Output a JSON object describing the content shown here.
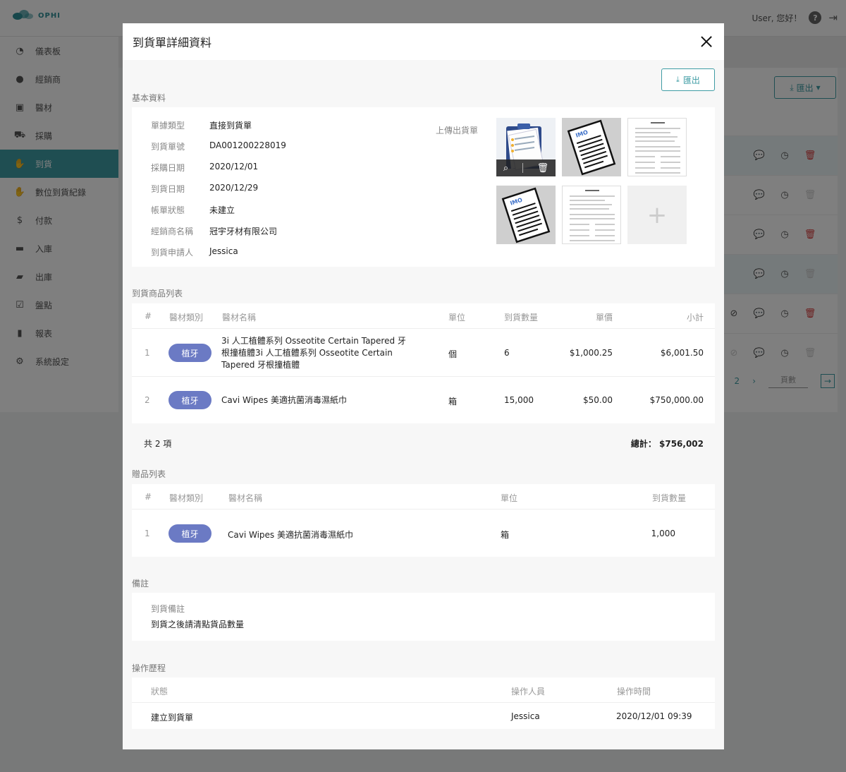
{
  "app": {
    "logo_text": "OPHI",
    "greeting": "User, 您好！",
    "help_glyph": "?",
    "logout_glyph": "⇥",
    "sidebar": [
      {
        "label": "儀表板",
        "icon": "dashboard-icon",
        "glyph": "◔",
        "active": false
      },
      {
        "label": "經銷商",
        "icon": "user-icon",
        "glyph": "●",
        "active": false
      },
      {
        "label": "醫材",
        "icon": "box-icon",
        "glyph": "▣",
        "active": false
      },
      {
        "label": "採購",
        "icon": "cart-icon",
        "glyph": "⛟",
        "active": false
      },
      {
        "label": "到貨",
        "icon": "handshake-icon",
        "glyph": "✋",
        "active": true
      },
      {
        "label": "數位到貨紀錄",
        "icon": "handshake-icon",
        "glyph": "✋",
        "active": false
      },
      {
        "label": "付款",
        "icon": "dollar-icon",
        "glyph": "$",
        "active": false
      },
      {
        "label": "入庫",
        "icon": "inbox-icon",
        "glyph": "▬",
        "active": false
      },
      {
        "label": "出庫",
        "icon": "outbox-icon",
        "glyph": "▰",
        "active": false
      },
      {
        "label": "盤點",
        "icon": "checklist-icon",
        "glyph": "☑",
        "active": false
      },
      {
        "label": "報表",
        "icon": "bar-chart-icon",
        "glyph": "▮",
        "active": false
      },
      {
        "label": "系統設定",
        "icon": "gear-icon",
        "glyph": "⚙",
        "active": false
      }
    ],
    "export_label": "匯出",
    "pager": {
      "page": "2",
      "next": "›",
      "input_placeholder": "頁數",
      "go": "→"
    }
  },
  "modal": {
    "title": "到貨單詳細資料",
    "export_label": "匯出",
    "basic": {
      "section_title": "基本資料",
      "fields": [
        {
          "label": "單據類型",
          "value": "直接到貨單"
        },
        {
          "label": "到貨單號",
          "value": "DA001200228019"
        },
        {
          "label": "採購日期",
          "value": "2020/12/01"
        },
        {
          "label": "到貨日期",
          "value": "2020/12/29"
        },
        {
          "label": "帳單狀態",
          "value": "未建立"
        },
        {
          "label": "經銷商名稱",
          "value": "冠宇牙材有限公司"
        },
        {
          "label": "到貨申請人",
          "value": "Jessica"
        }
      ],
      "upload_label": "上傳出貨單",
      "add_glyph": "+",
      "zoom_glyph": "⌕",
      "trash_glyph": "🗑"
    },
    "products": {
      "section_title": "到貨商品列表",
      "headers": {
        "no": "#",
        "category": "醫材類別",
        "name": "醫材名稱",
        "unit": "單位",
        "qty": "到貨數量",
        "price": "單價",
        "subtotal": "小計"
      },
      "rows": [
        {
          "no": "1",
          "category": "植牙",
          "name": "3i 人工植體系列 Osseotite Certain Tapered 牙根撞植體3i 人工植體系列 Osseotite Certain Tapered 牙根撞植體",
          "unit": "個",
          "qty": "6",
          "price": "$1,000.25",
          "subtotal": "$6,001.50"
        },
        {
          "no": "2",
          "category": "植牙",
          "name": "Cavi Wipes 美適抗菌消毒濕紙巾",
          "unit": "箱",
          "qty": "15,000",
          "price": "$50.00",
          "subtotal": "$750,000.00"
        }
      ],
      "count_text": "共 2 項",
      "total_text": "總計： $756,002"
    },
    "gifts": {
      "section_title": "贈品列表",
      "headers": {
        "no": "#",
        "category": "醫材類別",
        "name": "醫材名稱",
        "unit": "單位",
        "qty": "到貨數量"
      },
      "rows": [
        {
          "no": "1",
          "category": "植牙",
          "name": "Cavi Wipes 美適抗菌消毒濕紙巾",
          "unit": "箱",
          "qty": "1,000"
        }
      ]
    },
    "remarks": {
      "section_title": "備註",
      "label": "到貨備註",
      "text": "到貨之後請清點貨品數量"
    },
    "history": {
      "section_title": "操作歷程",
      "headers": {
        "status": "狀態",
        "operator": "操作人員",
        "time": "操作時間"
      },
      "rows": [
        {
          "status": "建立到貨單",
          "operator": "Jessica",
          "time": "2020/12/01 09:39"
        }
      ]
    }
  }
}
